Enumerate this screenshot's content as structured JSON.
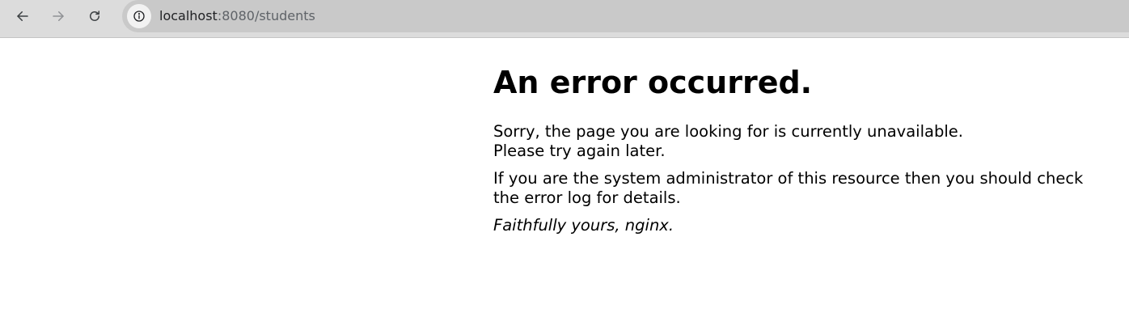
{
  "browser": {
    "url_host": "localhost",
    "url_rest": ":8080/students",
    "icons": {
      "back": "arrow-left-icon",
      "forward": "arrow-right-icon",
      "reload": "reload-icon",
      "site_info": "info-circle-icon"
    }
  },
  "page": {
    "heading": "An error occurred.",
    "paragraph1_line1": "Sorry, the page you are looking for is currently unavailable.",
    "paragraph1_line2": "Please try again later.",
    "paragraph2": "If you are the system administrator of this resource then you should check the error log for details.",
    "signature": "Faithfully yours, nginx."
  }
}
